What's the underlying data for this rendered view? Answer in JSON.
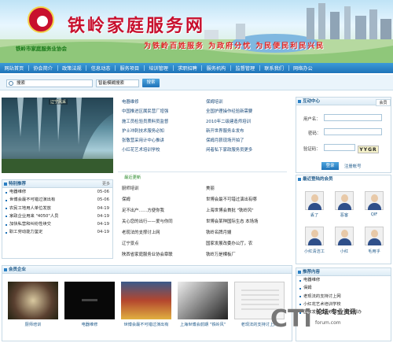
{
  "site_title": "铁岭家庭服务网",
  "org_name": "铁岭市家庭服务业协会",
  "slogan": "为铁岭百姓服务 为政府分忧 为民便民利民兴民",
  "nav": [
    "网站首页",
    "协会简介",
    "政策法规",
    "信息动态",
    "服务项目",
    "培训管理",
    "求职招聘",
    "服务机构",
    "监督管理",
    "联系我们",
    "网络办公"
  ],
  "search": {
    "placeholder": "搜索",
    "select": "智能模糊搜索",
    "button": "搜索"
  },
  "photo": {
    "caption": "辽宁风采"
  },
  "hot_recommend": {
    "title": "特别推荐",
    "more": "更多",
    "items": [
      {
        "t": "电器维修",
        "d": "05-06"
      },
      {
        "t": "世博会最不可错过演出有",
        "d": "05-06"
      },
      {
        "t": "农民工地用人单位发放",
        "d": "04-19"
      },
      {
        "t": "家政企业用来 \"4050\"人员",
        "d": "04-19"
      },
      {
        "t": "加快私营和纠纷性续交",
        "d": "04-19"
      },
      {
        "t": "职工劳动能力鉴定",
        "d": "04-19"
      }
    ]
  },
  "news_left": [
    "电器维修",
    "中国推进区属民营厂增强",
    "施工员检验员质料员监督",
    "护士冲刺技术服务必知",
    "张敬营采用计中心推讲",
    "小红花艺术培训学校"
  ],
  "news_right": [
    "保姆培训",
    "全国护理操作经验新需要",
    "2010年二级建造师培训",
    "新开世界服务业发布",
    "保姆月薪现场开拍了",
    "闲者私下家政服务员更多"
  ],
  "subhead": "最近更新",
  "news2_left": [
    "厨师培训",
    "保姆",
    "足不出户……方便你我",
    "关心您的出行——爱与你同",
    "老现法的支撑讨上网",
    "辽宁景点",
    "陕西省家庭服务业协会章联"
  ],
  "news2_right": [
    "美丽",
    "世博会最不可错过演出有哪",
    "上海世博会首批 \"铁岭风\"",
    "世博会某种国际生态 本场场",
    "铁岭名牌月嫂",
    "国家发展改委办公厅，农",
    "铁岭万是棵板厂"
  ],
  "login": {
    "title": "互动中心",
    "tab": "会员",
    "user_label": "用户名：",
    "pass_label": "密码：",
    "code_label": "验证码：",
    "captcha": "YYGR",
    "login_btn": "登录",
    "register": "注册帐号"
  },
  "members": {
    "title": "最近登陆的会员",
    "names": [
      "丢了",
      "恶客",
      "QIF",
      "中大",
      "小红",
      "老子",
      "小红清洁工",
      "小红",
      "毛用乎"
    ]
  },
  "member_enterprise": {
    "title": "会员企业",
    "captions": [
      "厨师培训",
      "电器维修",
      "世博会最不可错过演出有",
      "上海世博会前期 \"铁岭风\"",
      "老现法的支持讨上网"
    ]
  },
  "recommend_content": {
    "title": "推荐内容",
    "items": [
      "电器维修",
      "保姆",
      "老现法的支持讨上网",
      "小红花艺术培训学校",
      "国家发展改委办公厅，农业部办"
    ]
  },
  "watermark": {
    "big": "CTi",
    "line1": "论坛·专业资讯",
    "line2": "forum.com"
  }
}
